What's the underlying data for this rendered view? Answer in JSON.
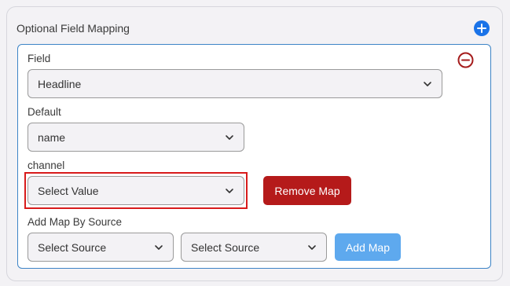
{
  "panel": {
    "title": "Optional Field Mapping"
  },
  "fields": {
    "field_label": "Field",
    "field_value": "Headline",
    "default_label": "Default",
    "default_value": "name",
    "channel_label": "channel",
    "channel_value": "Select Value",
    "remove_map_label": "Remove Map",
    "add_map_by_source_label": "Add Map By Source",
    "source_select_1": "Select Source",
    "source_select_2": "Select Source",
    "add_map_label": "Add Map"
  },
  "colors": {
    "primary_blue": "#1a73e8",
    "danger_red": "#b51a1a",
    "highlight_red": "#d81b1b",
    "add_map_blue": "#5ea9ee",
    "card_border": "#3d84c6"
  },
  "icons": {
    "add": "plus-circle-icon",
    "remove": "minus-circle-icon",
    "chevron": "chevron-down-icon"
  }
}
